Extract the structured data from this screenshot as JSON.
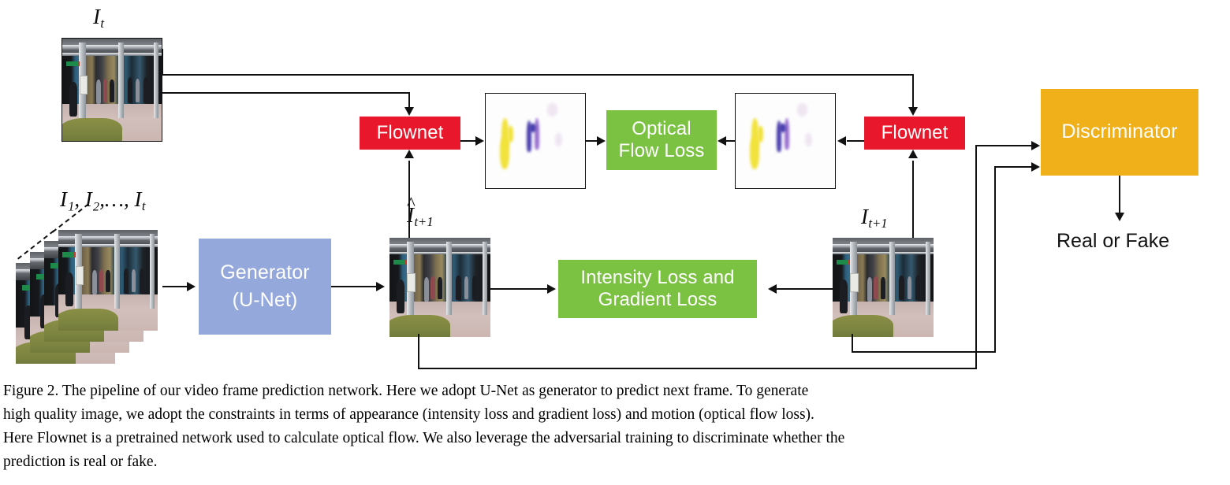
{
  "figure": {
    "caption_lines": [
      "Figure 2. The pipeline of our video frame prediction network.  Here we adopt U-Net as generator to predict next frame.  To generate",
      "high quality image, we adopt the constraints in terms of appearance (intensity loss and gradient loss) and motion (optical flow loss).",
      "Here Flownet is a pretrained network used to calculate optical flow. We also leverage the adversarial training to discriminate whether the",
      "prediction is real or fake."
    ]
  },
  "labels": {
    "input_frame_t": "I",
    "input_frame_t_sub": "t",
    "input_sequence": "I₁, I₂,…, I",
    "input_sequence_sub": "t",
    "predicted_frame": "I",
    "predicted_frame_sub": "t+1",
    "predicted_frame_hat": "^",
    "real_next_frame": "I",
    "real_next_frame_sub": "t+1",
    "output_text": "Real or Fake"
  },
  "blocks": {
    "flownet_left": {
      "label": "Flownet",
      "color": "#E8172B",
      "text_color": "#ffffff"
    },
    "flownet_right": {
      "label": "Flownet",
      "color": "#E8172B",
      "text_color": "#ffffff"
    },
    "optical_flow_loss": {
      "line1": "Optical",
      "line2": "Flow Loss",
      "color": "#7CC242",
      "text_color": "#ffffff"
    },
    "intensity_gradient_loss": {
      "line1": "Intensity Loss and",
      "line2": "Gradient Loss",
      "color": "#7CC242",
      "text_color": "#ffffff"
    },
    "generator": {
      "line1": "Generator",
      "line2": "(U-Net)",
      "color": "#94A8DB",
      "text_color": "#ffffff"
    },
    "discriminator": {
      "label": "Discriminator",
      "color": "#EFB01A",
      "text_color": "#ffffff"
    }
  },
  "thumbnails": {
    "input_frame": {
      "name": "frame-thumbnail-It",
      "kind": "street-scene"
    },
    "input_stack": {
      "name": "frame-stack-thumbnail",
      "kind": "street-scene-stack",
      "frames": 4
    },
    "predicted_frame": {
      "name": "frame-thumbnail-predicted",
      "kind": "street-scene"
    },
    "real_frame": {
      "name": "frame-thumbnail-real",
      "kind": "street-scene"
    },
    "flow_left": {
      "name": "optical-flow-thumbnail-predicted",
      "kind": "optical-flow"
    },
    "flow_right": {
      "name": "optical-flow-thumbnail-real",
      "kind": "optical-flow"
    }
  },
  "colors": {
    "red": "#E8172B",
    "green": "#7CC242",
    "orange": "#EFB01A",
    "blue": "#94A8DB",
    "line": "#111111",
    "background": "#FFFFFF"
  }
}
